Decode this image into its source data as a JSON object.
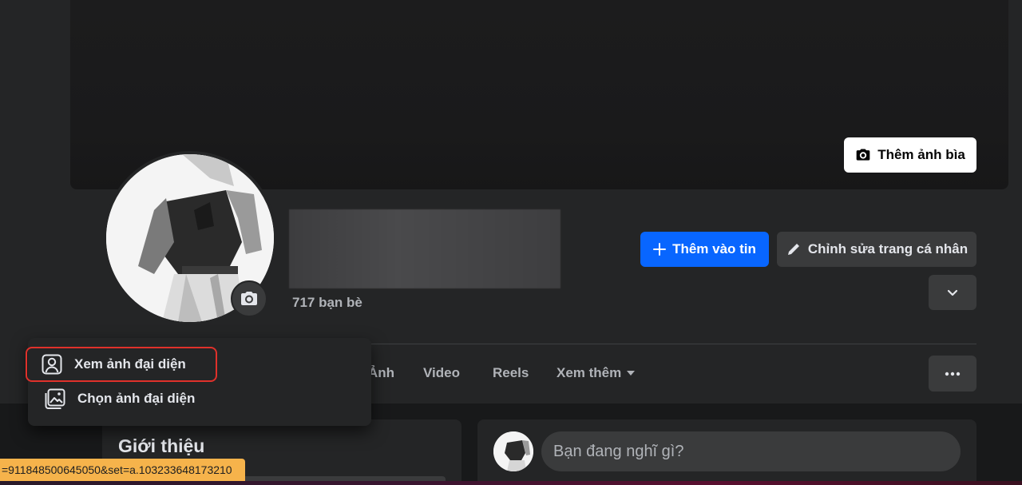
{
  "cover": {
    "add_cover_label": "Thêm ảnh bìa"
  },
  "profile": {
    "friends_count": "717 bạn bè"
  },
  "actions": {
    "add_story_label": "Thêm vào tin",
    "edit_profile_label": "Chỉnh sửa trang cá nhân"
  },
  "tabs": [
    {
      "label": "Ảnh"
    },
    {
      "label": "Video"
    },
    {
      "label": "Reels"
    },
    {
      "label": "Xem thêm"
    }
  ],
  "avatar_menu": {
    "items": [
      {
        "label": "Xem ảnh đại diện",
        "icon": "user-icon",
        "highlighted": true
      },
      {
        "label": "Chọn ảnh đại diện",
        "icon": "photo-icon",
        "highlighted": false
      }
    ]
  },
  "intro": {
    "title": "Giới thiệu"
  },
  "composer": {
    "placeholder": "Bạn đang nghĩ gì?"
  },
  "status_bar": {
    "url": "=911848500645050&set=a.103233648173210"
  },
  "colors": {
    "primary": "#0866ff",
    "surface": "#242526",
    "button": "#3a3b3c",
    "highlight_border": "#e0312b",
    "status_bar": "#f6b34b"
  }
}
